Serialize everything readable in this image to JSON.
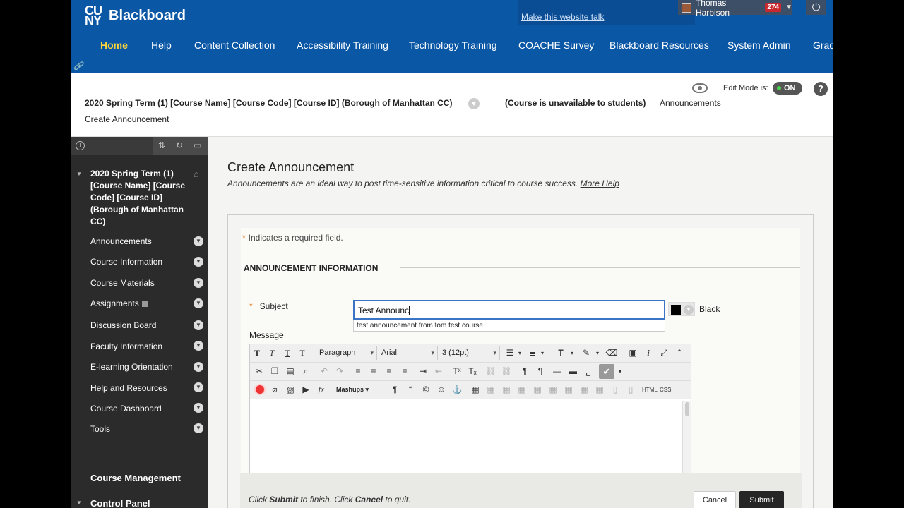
{
  "header": {
    "logo_mark": "CU NY",
    "logo_text": "Blackboard",
    "talk_link": "Make this website talk",
    "user_name": "Thomas Harbison",
    "user_badge": "274",
    "nav": [
      "Home",
      "Help",
      "Content Collection",
      "Accessibility Training",
      "Technology Training",
      "COACHE Survey",
      "Blackboard Resources",
      "System Admin",
      "Grad"
    ]
  },
  "course_bar": {
    "title": "2020 Spring Term (1) [Course Name] [Course Code] [Course ID] (Borough of Manhattan CC)",
    "status": "(Course is unavailable to students)",
    "page": "Announcements",
    "breadcrumb": "Create Announcement",
    "edit_mode_label": "Edit Mode is:",
    "edit_mode_value": "ON",
    "help_glyph": "?"
  },
  "sidebar": {
    "course_name": "2020 Spring Term (1) [Course Name] [Course Code] [Course ID] (Borough of Manhattan CC)",
    "items": [
      "Announcements",
      "Course Information",
      "Course Materials",
      "Assignments",
      "Discussion Board",
      "Faculty Information",
      "E-learning Orientation",
      "Help and Resources",
      "Course Dashboard",
      "Tools"
    ],
    "sections": [
      "Course Management",
      "Control Panel"
    ]
  },
  "main": {
    "title": "Create Announcement",
    "description": "Announcements are an ideal way to post time-sensitive information critical to course success.",
    "more_help": "More Help",
    "required_note": "Indicates a required field.",
    "required_star": "*",
    "section_title": "ANNOUNCEMENT INFORMATION",
    "subject_label": "Subject",
    "subject_value": "Test Announc",
    "suggestion": "test announcement from tom test course",
    "color_name": "Black",
    "message_label": "Message",
    "toolbar": {
      "format": "Paragraph",
      "font": "Arial",
      "size": "3 (12pt)",
      "mashups": "Mashups",
      "html": "HTML",
      "css": "CSS"
    },
    "submit_note": {
      "click1": "Click ",
      "submit_word": "Submit",
      "mid": " to finish. Click ",
      "cancel_word": "Cancel",
      "end": " to quit."
    },
    "cancel_label": "Cancel",
    "submit_label": "Submit"
  },
  "colors": {
    "header_bg": "#0a57a6",
    "nav_active": "#fbd43a",
    "sidebar_bg": "#2b2b2b",
    "accent_star": "#e07a1a"
  }
}
